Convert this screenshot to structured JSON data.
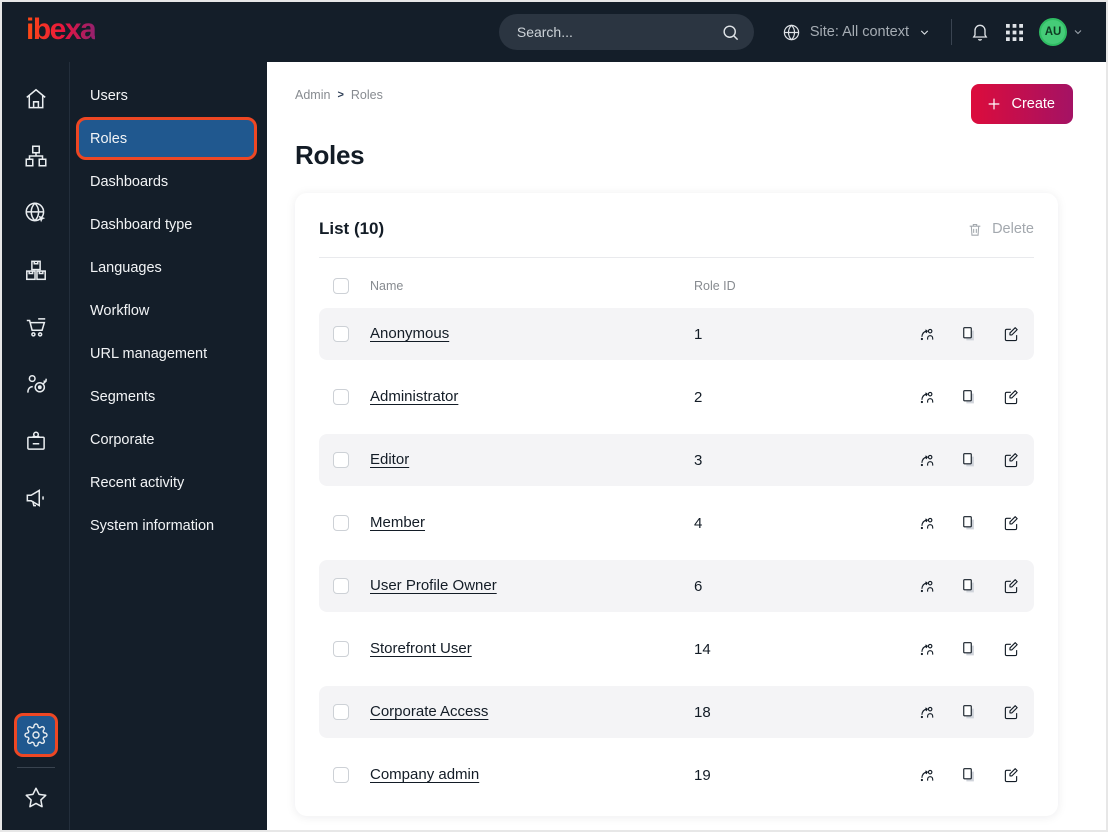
{
  "brand": {
    "logo_text": "ibexa"
  },
  "topbar": {
    "search_placeholder": "Search...",
    "site_context_label": "Site: All context",
    "avatar_initials": "AU",
    "icons": [
      "globe",
      "chevron-down",
      "notification-bell",
      "app-grid",
      "search-magnifier"
    ]
  },
  "nav_rail": {
    "items": [
      {
        "icon": "home"
      },
      {
        "icon": "content-tree"
      },
      {
        "icon": "site"
      },
      {
        "icon": "product-catalog"
      },
      {
        "icon": "commerce-cart"
      },
      {
        "icon": "personalization-target"
      },
      {
        "icon": "corporate-badge"
      },
      {
        "icon": "marketing-megaphone"
      }
    ],
    "bottom_items": [
      {
        "icon": "settings-gear",
        "highlighted": true
      },
      {
        "icon": "bookmarks-star",
        "highlighted": false
      }
    ]
  },
  "sidebar": {
    "items": [
      {
        "label": "Users"
      },
      {
        "label": "Roles",
        "selected": true
      },
      {
        "label": "Dashboards"
      },
      {
        "label": "Dashboard type"
      },
      {
        "label": "Languages"
      },
      {
        "label": "Workflow"
      },
      {
        "label": "URL management"
      },
      {
        "label": "Segments"
      },
      {
        "label": "Corporate"
      },
      {
        "label": "Recent activity"
      },
      {
        "label": "System information"
      }
    ]
  },
  "breadcrumb": {
    "items": [
      "Admin",
      "Roles"
    ],
    "separator": ">"
  },
  "header": {
    "title": "Roles",
    "create_label": "Create"
  },
  "list_card": {
    "title": "List (10)",
    "delete_label": "Delete",
    "columns": {
      "name": "Name",
      "role_id": "Role ID"
    },
    "row_action_icons": [
      "assign-to-user",
      "copy",
      "edit"
    ],
    "rows": [
      {
        "name": "Anonymous",
        "role_id": "1"
      },
      {
        "name": "Administrator",
        "role_id": "2"
      },
      {
        "name": "Editor",
        "role_id": "3"
      },
      {
        "name": "Member",
        "role_id": "4"
      },
      {
        "name": "User Profile Owner",
        "role_id": "6"
      },
      {
        "name": "Storefront User",
        "role_id": "14"
      },
      {
        "name": "Corporate Access",
        "role_id": "18"
      },
      {
        "name": "Company admin",
        "role_id": "19"
      }
    ]
  },
  "colors": {
    "topbar_bg": "#141e29",
    "accent_orange": "#ee4723",
    "selected_blue": "#20588f",
    "create_gradient_start": "#dc0c3c",
    "create_gradient_end": "#a41264",
    "avatar_green": "#45cc78",
    "row_stripe": "#f4f4f6",
    "text_dark": "#131c26",
    "text_gray": "#878b90"
  }
}
